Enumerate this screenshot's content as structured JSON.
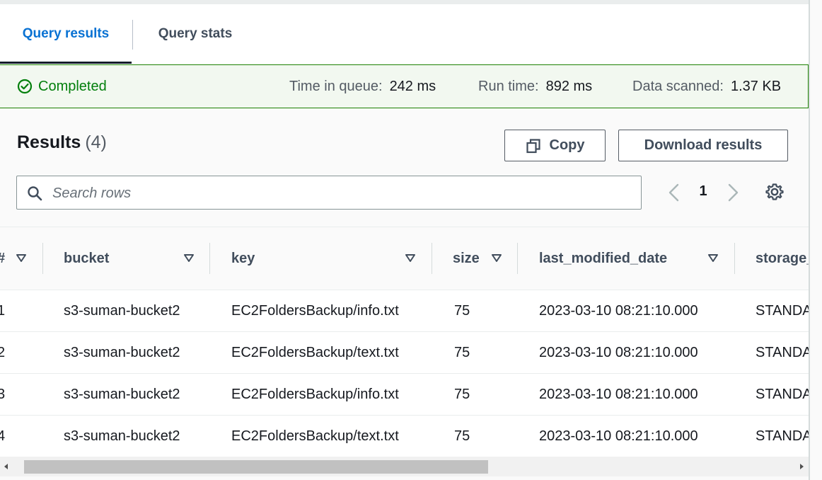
{
  "tabs": [
    {
      "label": "Query results",
      "active": true
    },
    {
      "label": "Query stats",
      "active": false
    }
  ],
  "status": {
    "state": "Completed",
    "icon": "check-circle-icon",
    "color": "#037f0c",
    "time_in_queue_label": "Time in queue:",
    "time_in_queue": "242 ms",
    "run_time_label": "Run time:",
    "run_time": "892 ms",
    "data_scanned_label": "Data scanned:",
    "data_scanned": "1.37 KB"
  },
  "results": {
    "title": "Results",
    "count": "(4)",
    "copy_label": "Copy",
    "download_label": "Download results",
    "search_placeholder": "Search rows",
    "page": "1"
  },
  "table": {
    "columns": [
      "#",
      "bucket",
      "key",
      "size",
      "last_modified_date",
      "storage_"
    ],
    "rows": [
      [
        "1",
        "s3-suman-bucket2",
        "EC2FoldersBackup/info.txt",
        "75",
        "2023-03-10 08:21:10.000",
        "STANDA"
      ],
      [
        "2",
        "s3-suman-bucket2",
        "EC2FoldersBackup/text.txt",
        "75",
        "2023-03-10 08:21:10.000",
        "STANDA"
      ],
      [
        "3",
        "s3-suman-bucket2",
        "EC2FoldersBackup/info.txt",
        "75",
        "2023-03-10 08:21:10.000",
        "STANDA"
      ],
      [
        "4",
        "s3-suman-bucket2",
        "EC2FoldersBackup/text.txt",
        "75",
        "2023-03-10 08:21:10.000",
        "STANDA"
      ]
    ]
  },
  "colors": {
    "accent": "#0972d3",
    "success_bg": "#f2f8f0",
    "success_border": "#1d8102"
  }
}
